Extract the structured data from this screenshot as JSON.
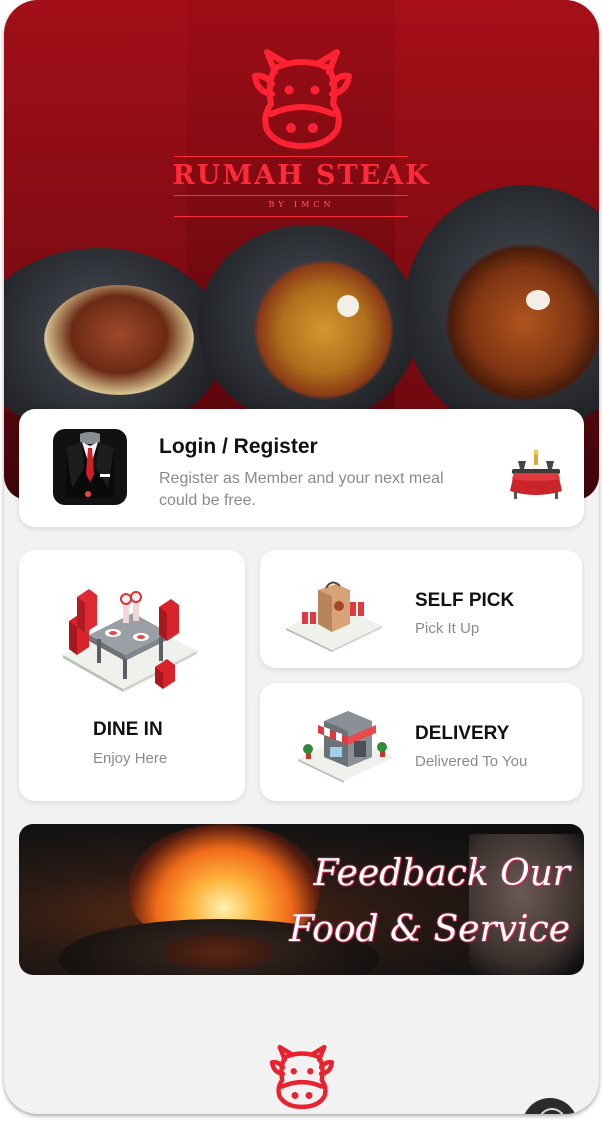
{
  "hero": {
    "brand": "RUMAH STEAK",
    "brand_sub": "BY IMCN",
    "logo_icon": "cow-head-icon"
  },
  "login": {
    "title": "Login / Register",
    "subtitle": "Register as Member and your next meal could be free.",
    "avatar_icon": "suit-avatar-icon",
    "dining_icon": "dining-table-icon"
  },
  "services": {
    "dine_in": {
      "title": "DINE IN",
      "subtitle": "Enjoy Here",
      "icon": "dining-table-icon"
    },
    "self_pick": {
      "title": "SELF PICK",
      "subtitle": "Pick It Up",
      "icon": "shopping-bag-icon"
    },
    "delivery": {
      "title": "DELIVERY",
      "subtitle": "Delivered To You",
      "icon": "storefront-icon"
    }
  },
  "banner": {
    "line1": "Feedback Our",
    "line2": "Food & Service"
  },
  "colors": {
    "brand_red": "#e8222e",
    "hero_red": "#9b0d16",
    "background": "#f2f2f2"
  }
}
